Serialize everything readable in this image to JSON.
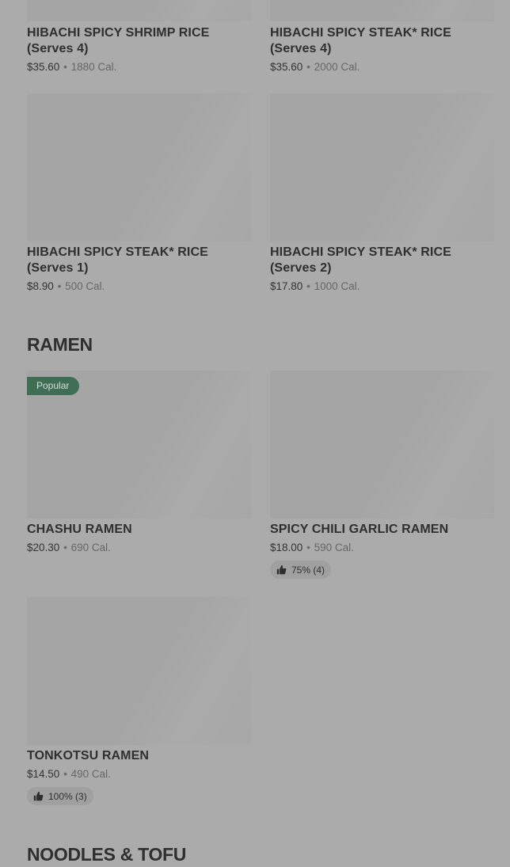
{
  "sections": {
    "top": {
      "items": [
        {
          "name": "HIBACHI SPICY SHRIMP RICE (Serves 4)",
          "price": "$35.60",
          "separator": "•",
          "calories": "1880 Cal."
        },
        {
          "name": "HIBACHI SPICY STEAK* RICE (Serves 4)",
          "price": "$35.60",
          "separator": "•",
          "calories": "2000 Cal."
        },
        {
          "name": "HIBACHI SPICY STEAK* RICE (Serves 1)",
          "price": "$8.90",
          "separator": "•",
          "calories": "500 Cal."
        },
        {
          "name": "HIBACHI SPICY STEAK* RICE (Serves 2)",
          "price": "$17.80",
          "separator": "•",
          "calories": "1000 Cal."
        }
      ]
    },
    "ramen": {
      "title": "RAMEN",
      "items": [
        {
          "name": "CHASHU RAMEN",
          "price": "$20.30",
          "separator": "•",
          "calories": "690 Cal.",
          "badge": "Popular"
        },
        {
          "name": "SPICY CHILI GARLIC RAMEN",
          "price": "$18.00",
          "separator": "•",
          "calories": "590 Cal.",
          "rating": "75% (4)"
        },
        {
          "name": "TONKOTSU RAMEN",
          "price": "$14.50",
          "separator": "•",
          "calories": "490 Cal.",
          "rating": "100% (3)"
        }
      ]
    },
    "noodles": {
      "title": "NOODLES & TOFU"
    }
  },
  "icons": {
    "rating": "thumbs-up-icon"
  },
  "colors": {
    "overlay_background": "#ababab",
    "badge_background": "#3f6e55",
    "text": "#2f2f2f"
  }
}
